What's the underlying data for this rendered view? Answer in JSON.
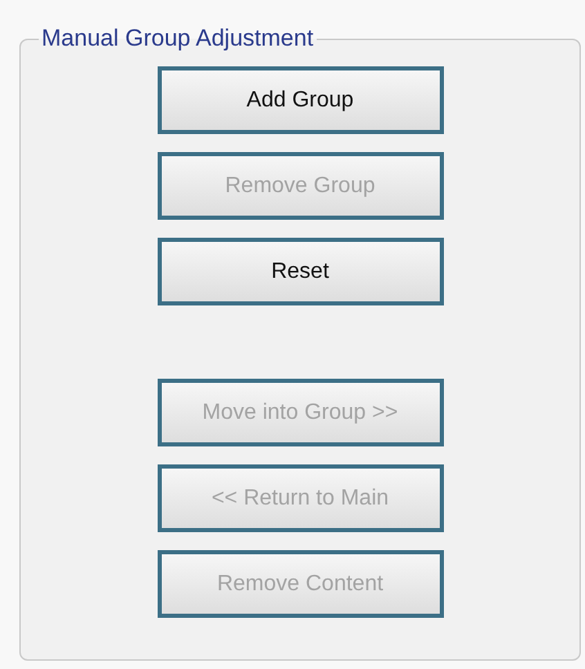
{
  "group": {
    "title": "Manual Group Adjustment"
  },
  "button_sets": [
    {
      "buttons": [
        {
          "label": "Add Group",
          "disabled": false
        },
        {
          "label": "Remove Group",
          "disabled": true
        },
        {
          "label": "Reset",
          "disabled": false
        }
      ]
    },
    {
      "buttons": [
        {
          "label": "Move into Group >>",
          "disabled": true
        },
        {
          "label": "<< Return to Main",
          "disabled": true
        },
        {
          "label": "Remove Content",
          "disabled": true
        }
      ]
    }
  ]
}
